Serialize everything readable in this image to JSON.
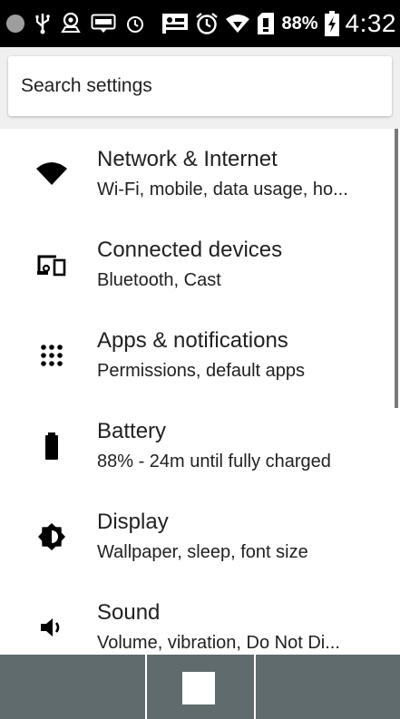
{
  "status_bar": {
    "icons_left": [
      "circle-icon",
      "usb-icon",
      "location-icon",
      "wifi-box-icon",
      "alarm-icon"
    ],
    "icons_right": [
      "notification-icon",
      "alarm-icon",
      "wifi-signal-icon",
      "sim-icon"
    ],
    "battery_percent": "88%",
    "time": "4:32"
  },
  "search": {
    "placeholder": "Search settings"
  },
  "settings_items": [
    {
      "icon": "wifi-icon",
      "title": "Network & Internet",
      "subtitle": "Wi-Fi, mobile, data usage, ho..."
    },
    {
      "icon": "devices-icon",
      "title": "Connected devices",
      "subtitle": "Bluetooth, Cast"
    },
    {
      "icon": "apps-grid-icon",
      "title": "Apps & notifications",
      "subtitle": "Permissions, default apps"
    },
    {
      "icon": "battery-icon",
      "title": "Battery",
      "subtitle": "88% - 24m until fully charged"
    },
    {
      "icon": "brightness-icon",
      "title": "Display",
      "subtitle": "Wallpaper, sleep, font size"
    },
    {
      "icon": "volume-icon",
      "title": "Sound",
      "subtitle": "Volume, vibration, Do Not Di..."
    }
  ],
  "colors": {
    "status_bar_bg": "#000000",
    "search_area_bg": "#f0f0f0",
    "nav_bar_bg": "#5f6b6c",
    "text_primary": "#212121"
  }
}
